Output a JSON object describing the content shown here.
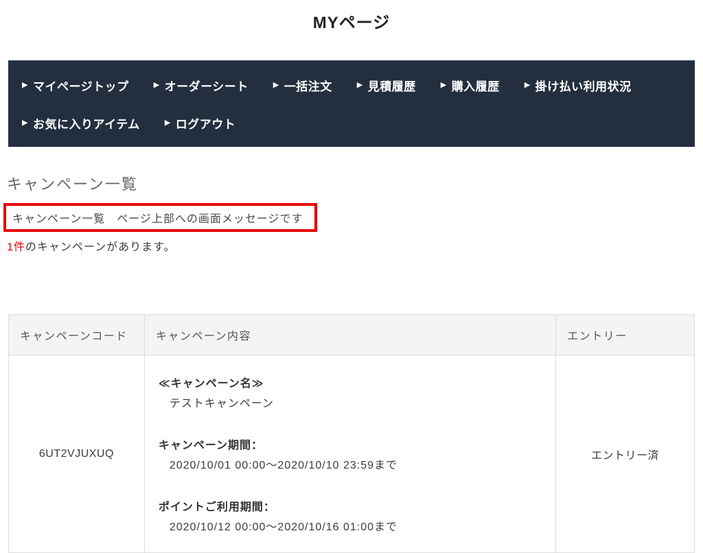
{
  "page": {
    "title": "MYページ"
  },
  "nav": {
    "bg_color": "#232f3e",
    "arrow": "▶",
    "items": [
      {
        "label": "マイページトップ"
      },
      {
        "label": "オーダーシート"
      },
      {
        "label": "一括注文"
      },
      {
        "label": "見積履歴"
      },
      {
        "label": "購入履歴"
      },
      {
        "label": "掛け払い利用状況"
      },
      {
        "label": "お気に入りアイテム"
      },
      {
        "label": "ログアウト"
      }
    ]
  },
  "main": {
    "heading": "キャンペーン一覧",
    "message": "キャンペーン一覧　ページ上部への画面メッセージです",
    "message_border_color": "#e60000",
    "count_highlight": "1件",
    "count_rest": "のキャンペーンがあります。"
  },
  "table": {
    "headers": {
      "code": "キャンペーンコード",
      "desc": "キャンペーン内容",
      "entry": "エントリー"
    },
    "rows": [
      {
        "code": "6UT2VJUXUQ",
        "name_label": "≪キャンペーン名≫",
        "name": "テストキャンペーン",
        "period_label": "キャンペーン期間：",
        "period": "2020/10/01 00:00～2020/10/10 23:59まで",
        "point_period_label": "ポイントご利用期間：",
        "point_period": "2020/10/12 00:00～2020/10/16 01:00まで",
        "entry_status": "エントリー済"
      }
    ]
  }
}
